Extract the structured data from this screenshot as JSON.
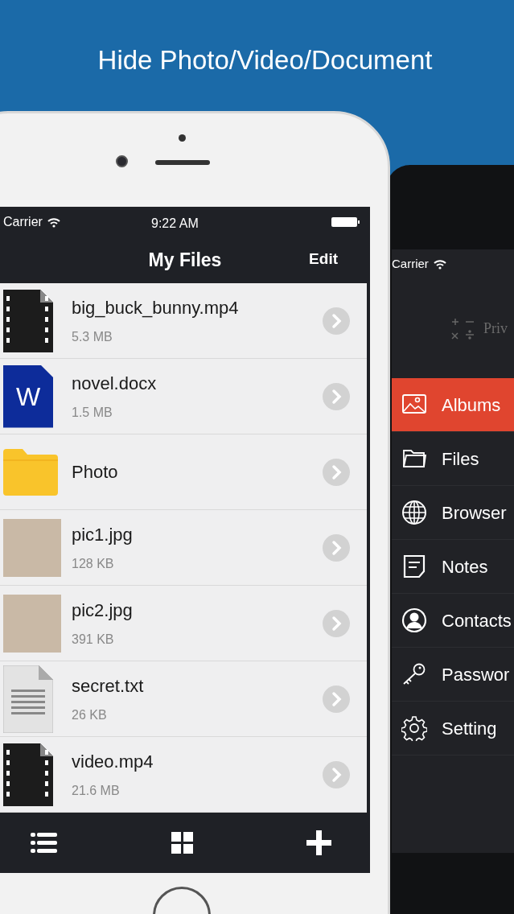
{
  "headline": "Hide Photo/Video/Document",
  "main_phone": {
    "status_bar": {
      "carrier": "Carrier",
      "time": "9:22 AM"
    },
    "nav_bar": {
      "title": "My Files",
      "edit": "Edit"
    },
    "files": [
      {
        "kind": "video",
        "name": "big_buck_bunny.mp4",
        "size": "5.3 MB"
      },
      {
        "kind": "document",
        "name": "novel.docx",
        "size": "1.5 MB",
        "badge": "W"
      },
      {
        "kind": "folder",
        "name": "Photo"
      },
      {
        "kind": "photo",
        "name": "pic1.jpg",
        "size": "128 KB"
      },
      {
        "kind": "photo",
        "name": "pic2.jpg",
        "size": "391 KB"
      },
      {
        "kind": "text",
        "name": "secret.txt",
        "size": "26 KB"
      },
      {
        "kind": "video",
        "name": "video.mp4",
        "size": "21.6 MB"
      }
    ]
  },
  "side_phone": {
    "status_bar": {
      "carrier": "Carrier"
    },
    "logo_text": "Priv",
    "menu": [
      {
        "kind": "image",
        "label": "Albums",
        "selected": true
      },
      {
        "kind": "folder",
        "label": "Files",
        "selected": false
      },
      {
        "kind": "globe",
        "label": "Browser",
        "selected": false
      },
      {
        "kind": "note",
        "label": "Notes",
        "selected": false
      },
      {
        "kind": "person",
        "label": "Contacts",
        "selected": false
      },
      {
        "kind": "key",
        "label": "Passwor",
        "selected": false
      },
      {
        "kind": "gear",
        "label": "Setting",
        "selected": false
      }
    ]
  }
}
